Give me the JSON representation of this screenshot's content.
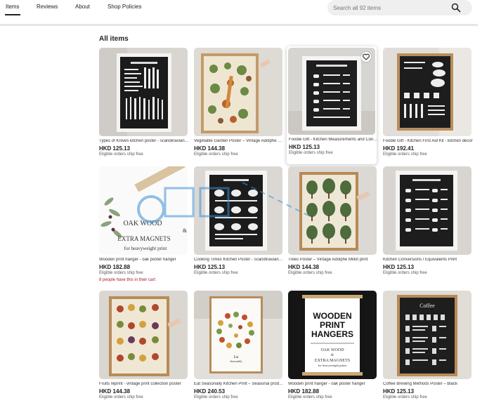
{
  "nav": {
    "tabs": [
      {
        "label": "Items"
      },
      {
        "label": "Reviews"
      },
      {
        "label": "About"
      },
      {
        "label": "Shop Policies"
      }
    ]
  },
  "search": {
    "placeholder": "Search all 92 items",
    "icon": "search-icon"
  },
  "section": {
    "title": "All items"
  },
  "products": [
    {
      "title": "Types of Knives kitchen poster - scandinavian kitchen decor",
      "price": "HKD 125.13",
      "ship": "Eligible orders ship free"
    },
    {
      "title": "Vegetable Garden Poster – Vintage Adolphe Millot print",
      "price": "HKD 144.38",
      "ship": "Eligible orders ship free"
    },
    {
      "title": "Foodie Gift - Kitchen Measurements and Conversions",
      "price": "HKD 125.13",
      "ship": "Eligible orders ship free"
    },
    {
      "title": "Foodie Gift - Kitchen First Aid Kit - kitchen decor",
      "price": "HKD 192.41",
      "ship": "Eligible orders ship free"
    },
    {
      "title": "Wooden print hanger - oak poster hanger",
      "price": "HKD 182.88",
      "ship": "Eligible orders ship free",
      "extra": "8 people have this in their cart"
    },
    {
      "title": "Cooking Times Kitchen Poster - scandinavian kitchen",
      "price": "HKD 125.13",
      "ship": "Eligible orders ship free"
    },
    {
      "title": "Trees Poster – Vintage Adolphe Millot print",
      "price": "HKD 144.38",
      "ship": "Eligible orders ship free"
    },
    {
      "title": "Kitchen Conversions / Equivalents Print",
      "price": "HKD 125.13",
      "ship": "Eligible orders ship free"
    },
    {
      "title": "Fruits reprint - vintage print collection poster",
      "price": "HKD 144.38",
      "ship": "Eligible orders ship free"
    },
    {
      "title": "Eat Seasonally Kitchen Print – Seasonal produce",
      "price": "HKD 240.53",
      "ship": "Eligible orders ship free"
    },
    {
      "title": "Wooden print hanger - oak poster hanger",
      "price": "HKD 182.88",
      "ship": "Eligible orders ship free"
    },
    {
      "title": "Coffee Brewing Methods Poster – Black",
      "price": "HKD 125.13",
      "ship": "Eligible orders ship free"
    }
  ],
  "artwork": {
    "hanger_text": [
      "OAK WOOD",
      "&",
      "EXTRA MAGNETS",
      "for heavyweight print"
    ],
    "hangers_title": [
      "WOODEN",
      "PRINT",
      "HANGERS"
    ],
    "hangers_sub": [
      "OAK WOOD",
      "&",
      "EXTRA MAGNETS",
      "for heavyweight prints"
    ],
    "coffee_title": "Coffee",
    "eat_caption": [
      "Eat",
      "Seasonally"
    ]
  },
  "colors": {
    "accent": "#222222",
    "cart_alert": "#a61a2e",
    "search_bg": "#efefef"
  }
}
